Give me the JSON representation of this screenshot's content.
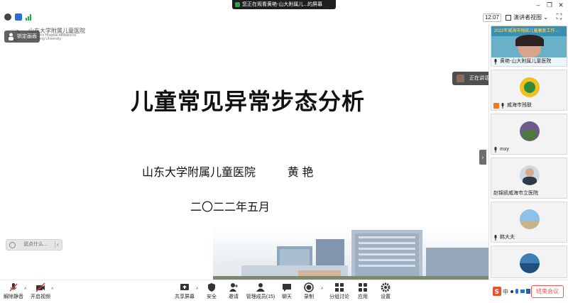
{
  "topbar": {
    "share_banner_text": "您正在观看黄艳-山大附属儿...的屏幕",
    "time": "12:07",
    "view_label": "演讲者视图"
  },
  "slide": {
    "logo_cn": "山东大学附属儿童医院",
    "logo_en_line1": "Children's Hospital Affiliated to",
    "logo_en_line2": "Shandong University",
    "title": "儿童常见异常步态分析",
    "presenter_org": "山东大学附属儿童医院",
    "presenter_name": "黄  艳",
    "date": "二〇二二年五月"
  },
  "overlay": {
    "lock_label": "锁定画面",
    "chat_placeholder": "说点什么...",
    "speaking_text": "正在讲话: 黄艳-山大附属儿童..."
  },
  "participants": [
    {
      "name": "黄艳-山大附属儿童医院",
      "banner": "2022年威海市残疾儿童康复工作..."
    },
    {
      "name": "威海市残联"
    },
    {
      "name": "mxy"
    },
    {
      "name": "赵锦凯威海市立医院"
    },
    {
      "name": "韩大夫"
    },
    {
      "name": ""
    }
  ],
  "toolbar": {
    "mute": "解除静音",
    "video": "开启视频",
    "share": "共享屏幕",
    "security": "安全",
    "invite": "邀请",
    "members": "管理成员(15)",
    "chat": "聊天",
    "record": "录制",
    "breakout": "分组讨论",
    "apps": "应用",
    "settings": "设置",
    "leave": "结束会议"
  },
  "colors": {
    "accent_green": "#22a845",
    "leave_red": "#e55555"
  }
}
